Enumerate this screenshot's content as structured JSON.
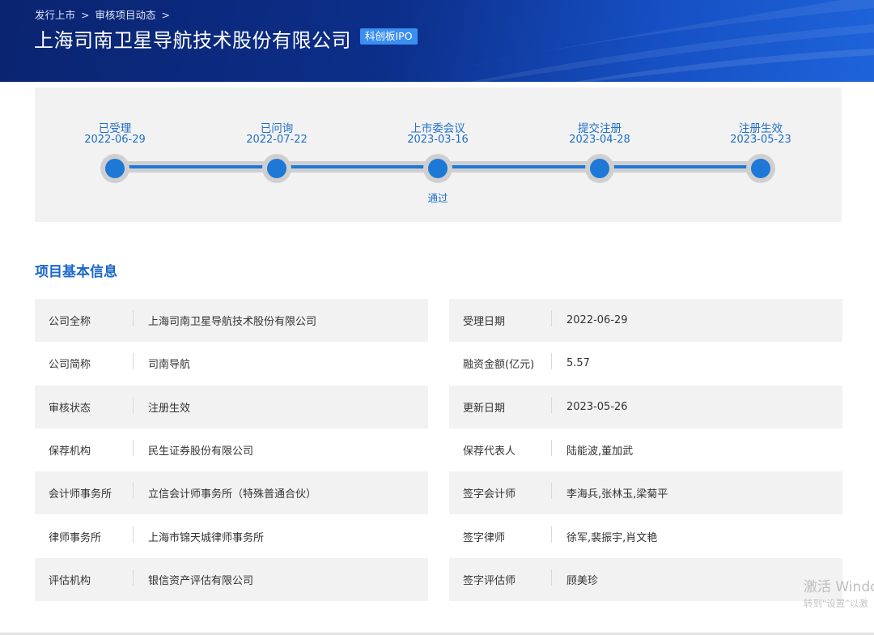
{
  "breadcrumb": {
    "item1": "发行上市",
    "item2": "审核项目动态",
    "separator": ">"
  },
  "header": {
    "title": "上海司南卫星导航技术股份有限公司",
    "badge": "科创板IPO"
  },
  "timeline": {
    "steps": [
      {
        "name": "已受理",
        "date": "2022-06-29",
        "result": ""
      },
      {
        "name": "已问询",
        "date": "2022-07-22",
        "result": ""
      },
      {
        "name": "上市委会议",
        "date": "2023-03-16",
        "result": "通过"
      },
      {
        "name": "提交注册",
        "date": "2023-04-28",
        "result": ""
      },
      {
        "name": "注册生效",
        "date": "2023-05-23",
        "result": ""
      }
    ]
  },
  "section": {
    "title": "项目基本信息"
  },
  "info": {
    "left": [
      {
        "label": "公司全称",
        "value": "上海司南卫星导航技术股份有限公司"
      },
      {
        "label": "公司简称",
        "value": "司南导航"
      },
      {
        "label": "审核状态",
        "value": "注册生效"
      },
      {
        "label": "保荐机构",
        "value": "民生证券股份有限公司"
      },
      {
        "label": "会计师事务所",
        "value": "立信会计师事务所（特殊普通合伙）"
      },
      {
        "label": "律师事务所",
        "value": "上海市锦天城律师事务所"
      },
      {
        "label": "评估机构",
        "value": "银信资产评估有限公司"
      }
    ],
    "right": [
      {
        "label": "受理日期",
        "value": "2022-06-29"
      },
      {
        "label": "融资金额(亿元)",
        "value": "5.57"
      },
      {
        "label": "更新日期",
        "value": "2023-05-26"
      },
      {
        "label": "保荐代表人",
        "value": "陆能波,董加武"
      },
      {
        "label": "签字会计师",
        "value": "李海兵,张林玉,梁菊平"
      },
      {
        "label": "签字律师",
        "value": "徐军,裴振宇,肖文艳"
      },
      {
        "label": "签字评估师",
        "value": "顾美珍"
      }
    ]
  },
  "watermark": {
    "line1": "激活 Windo",
    "line2": "转到\"设置\"以激"
  },
  "colors": {
    "accent": "#1e78d6",
    "banner": "#0c2f8a",
    "badge": "#3a8ff0"
  }
}
